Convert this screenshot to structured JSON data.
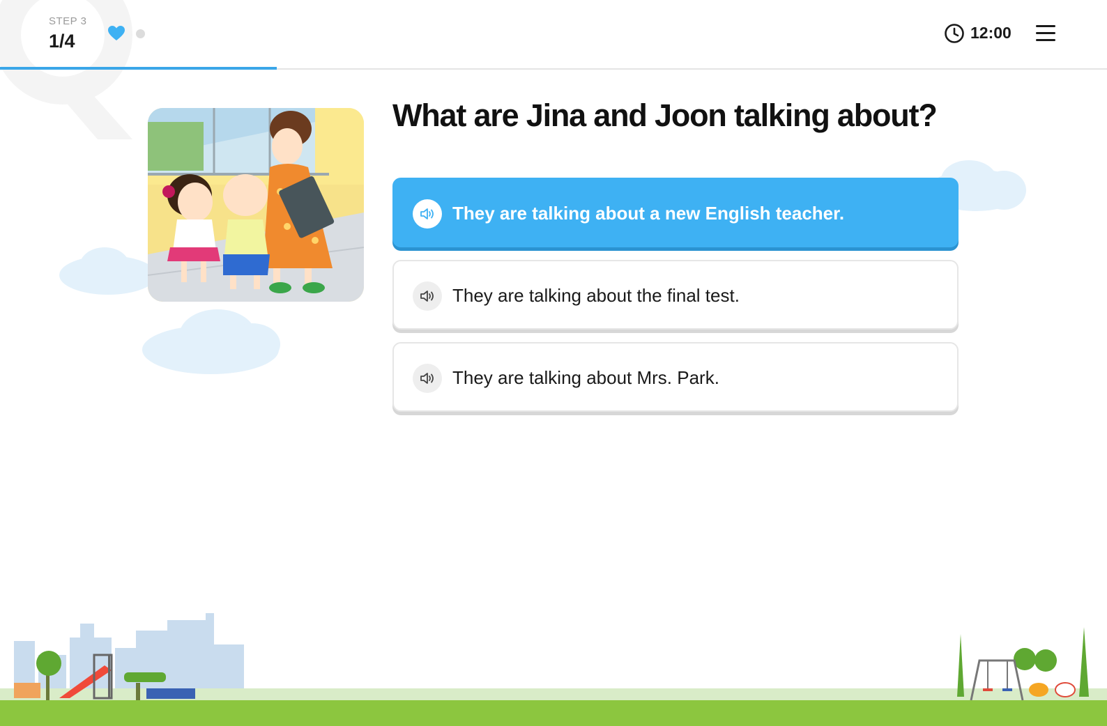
{
  "header": {
    "step_label": "STEP 3",
    "step_count": "1/4",
    "progress_fraction": 0.25,
    "lives": {
      "filled": 1,
      "empty": 1
    },
    "timer": "12:00",
    "icons": [
      "heart-icon",
      "clock-icon",
      "menu-icon"
    ]
  },
  "question": {
    "text": "What are Jina and Joon talking about?"
  },
  "options": [
    {
      "text": "They are talking about a new English teacher.",
      "selected": true
    },
    {
      "text": "They are talking about the final test.",
      "selected": false
    },
    {
      "text": "They are talking about Mrs. Park.",
      "selected": false
    }
  ],
  "colors": {
    "accent": "#3eb1f3",
    "progress": "#3aa6e8",
    "cloud": "#e3f1fb",
    "grass": "#8cc63f",
    "grass_light": "#d9ecc8"
  }
}
